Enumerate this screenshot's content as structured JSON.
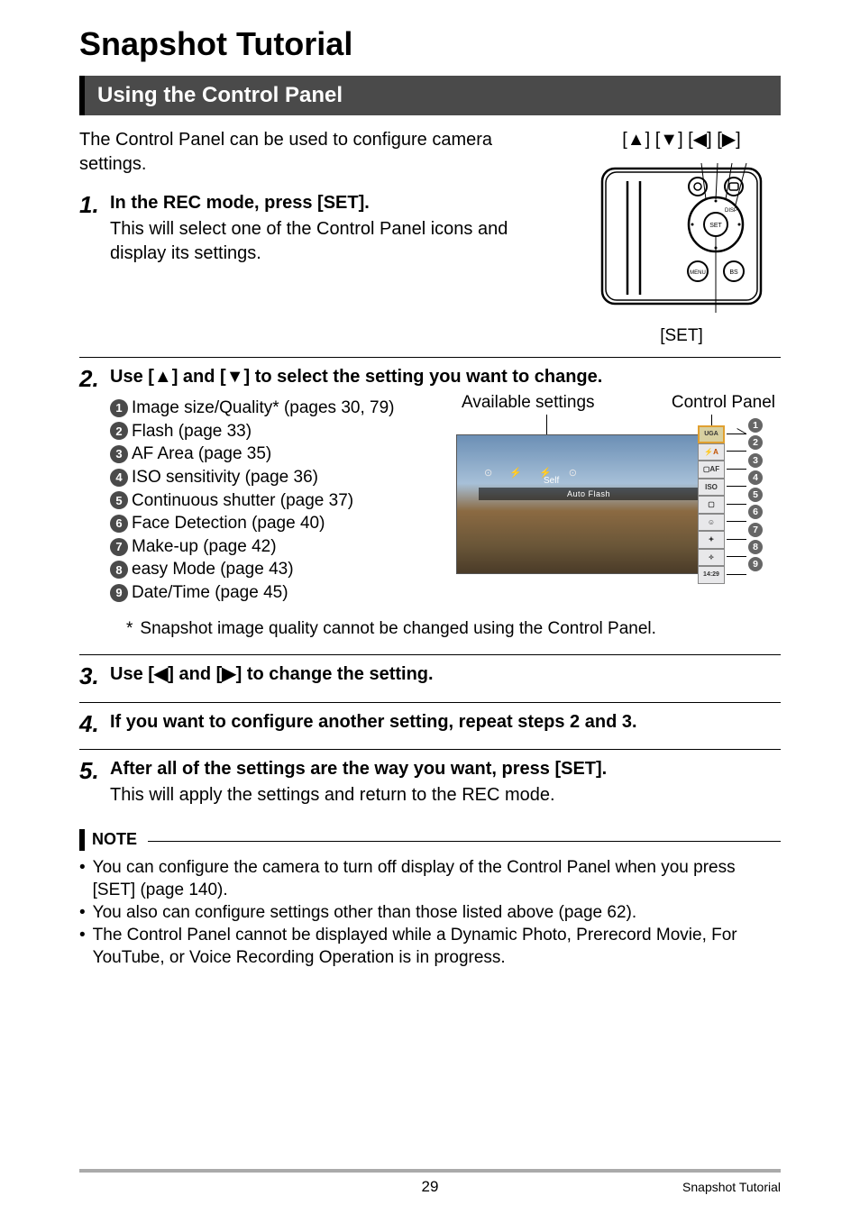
{
  "chapter_title": "Snapshot Tutorial",
  "section_title": "Using the Control Panel",
  "intro": "The Control Panel can be used to configure camera settings.",
  "dpad_label": "[▲] [▼] [◀] [▶]",
  "set_label": "[SET]",
  "steps": {
    "s1": {
      "num": "1.",
      "head": "In the REC mode, press [SET].",
      "desc": "This will select one of the Control Panel icons and display its settings."
    },
    "s2": {
      "num": "2.",
      "head": "Use [▲] and [▼] to select the setting you want to change."
    },
    "s3": {
      "num": "3.",
      "head": "Use [◀] and [▶] to change the setting."
    },
    "s4": {
      "num": "4.",
      "head": "If you want to configure another setting, repeat steps 2 and 3."
    },
    "s5": {
      "num": "5.",
      "head": "After all of the settings are the way you want, press [SET].",
      "desc": "This will apply the settings and return to the REC mode."
    }
  },
  "settings": [
    "Image size/Quality* (pages 30, 79)",
    "Flash (page 33)",
    "AF Area (page 35)",
    "ISO sensitivity (page 36)",
    "Continuous shutter (page 37)",
    "Face Detection (page 40)",
    "Make-up (page 42)",
    "easy Mode (page 43)",
    "Date/Time (page 45)"
  ],
  "panel_labels": {
    "available": "Available settings",
    "control_panel": "Control Panel",
    "auto_flash": "Auto Flash",
    "self": "Self",
    "time": "14:29",
    "iso": "ISO"
  },
  "asterisk": {
    "mark": "*",
    "text": "Snapshot image quality cannot be changed using the Control Panel."
  },
  "note_label": "NOTE",
  "notes": [
    "You can configure the camera to turn off display of the Control Panel when you press [SET] (page 140).",
    "You also can configure settings other than those listed above (page 62).",
    "The Control Panel cannot be displayed while a Dynamic Photo, Prerecord Movie, For YouTube, or Voice Recording Operation is in progress."
  ],
  "page_number": "29",
  "footer_title": "Snapshot Tutorial"
}
